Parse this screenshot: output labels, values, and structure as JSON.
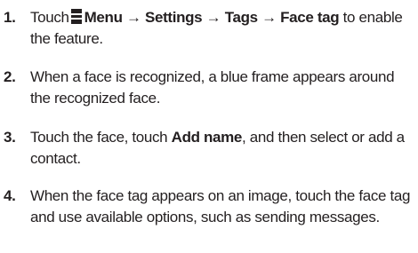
{
  "steps": [
    {
      "number": "1.",
      "prefix": "Touch",
      "menu_icon": "menu-key-icon",
      "menu": "Menu",
      "arrow": "→",
      "settings": "Settings",
      "tags": "Tags",
      "face_tag": "Face tag",
      "suffix": "to enable the feature."
    },
    {
      "number": "2.",
      "text": "When a face is recognized, a blue frame appears around the recognized face."
    },
    {
      "number": "3.",
      "prefix": "Touch the face, touch",
      "bold": "Add name",
      "suffix": ", and then select or add a contact."
    },
    {
      "number": "4.",
      "text": "When the face tag appears on an image, touch the face tag and use available options, such as sending messages."
    }
  ]
}
